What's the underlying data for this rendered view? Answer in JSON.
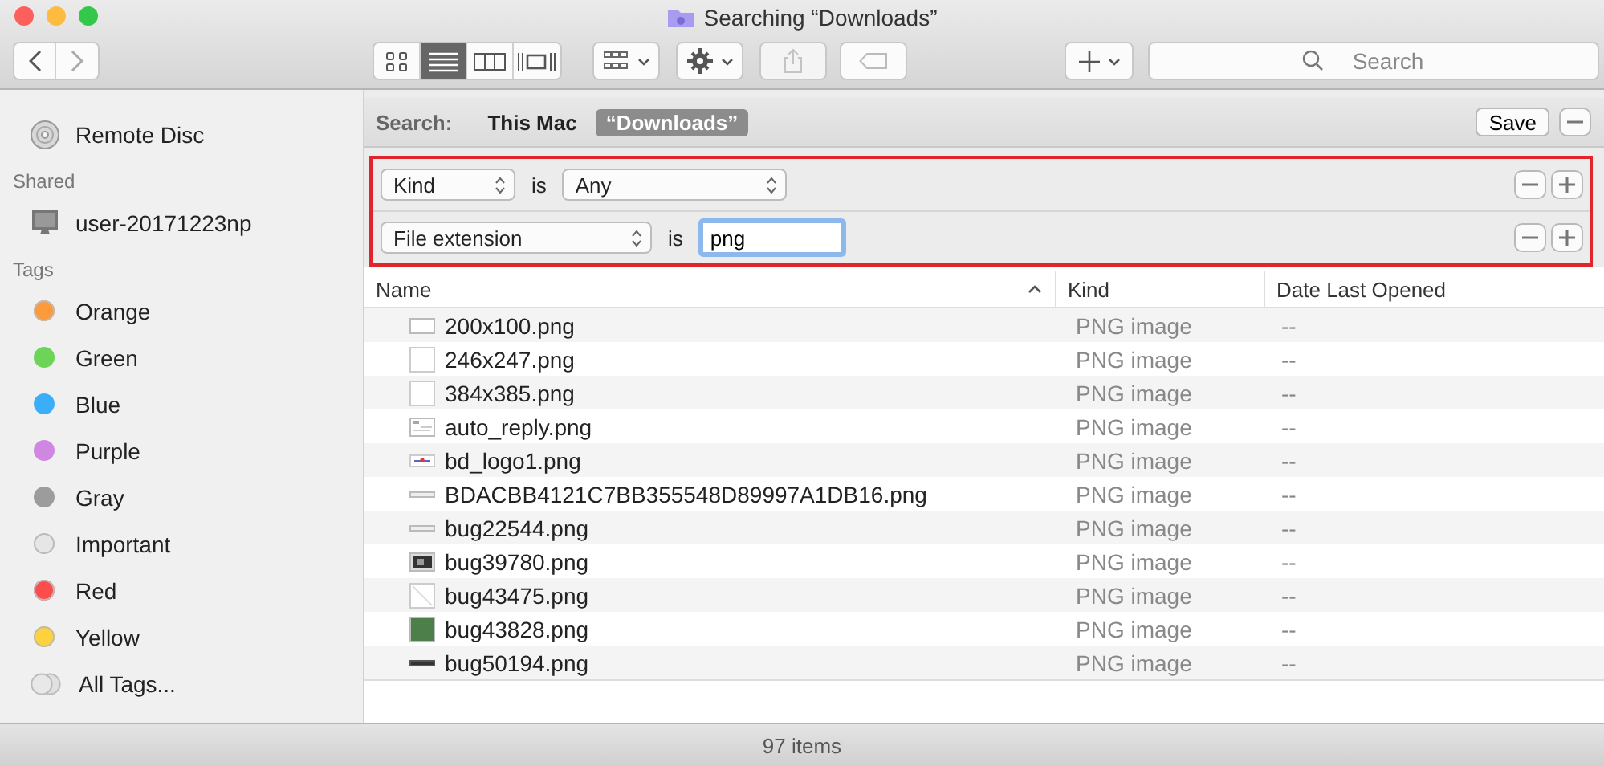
{
  "window": {
    "title": "Searching “Downloads”"
  },
  "toolbar": {
    "views": [
      {
        "kind": "icons",
        "selected": false
      },
      {
        "kind": "list",
        "selected": true
      },
      {
        "kind": "columns",
        "selected": false
      },
      {
        "kind": "gallery",
        "selected": false
      }
    ],
    "share_disabled": true,
    "search": {
      "placeholder": "Search"
    }
  },
  "sidebar": {
    "sections": [
      {
        "items": [
          {
            "label": "Remote Disc",
            "kind": "disc"
          }
        ]
      },
      {
        "title": "Shared",
        "items": [
          {
            "label": "user-20171223np",
            "kind": "computer"
          }
        ]
      },
      {
        "title": "Tags",
        "items": [
          {
            "label": "Orange",
            "kind": "tag",
            "color": "#fd9a3c"
          },
          {
            "label": "Green",
            "kind": "tag",
            "color": "#6cd558"
          },
          {
            "label": "Blue",
            "kind": "tag",
            "color": "#3aaef9"
          },
          {
            "label": "Purple",
            "kind": "tag",
            "color": "#cf87e1"
          },
          {
            "label": "Gray",
            "kind": "tag",
            "color": "#9c9c9c"
          },
          {
            "label": "Important",
            "kind": "tag",
            "color": "#e6e6e6"
          },
          {
            "label": "Red",
            "kind": "tag",
            "color": "#fc4c4c"
          },
          {
            "label": "Yellow",
            "kind": "tag",
            "color": "#fed23e"
          },
          {
            "label": "All Tags...",
            "kind": "alltags"
          }
        ]
      }
    ]
  },
  "search_bar": {
    "label": "Search:",
    "scopes": [
      {
        "label": "This Mac",
        "selected": false
      },
      {
        "label": "“Downloads”",
        "selected": true
      }
    ],
    "save": "Save"
  },
  "criteria": [
    {
      "attribute": "Kind",
      "operator": "is",
      "value": "Any",
      "kind": "popup"
    },
    {
      "attribute": "File extension",
      "operator": "is",
      "value": "png",
      "kind": "field"
    }
  ],
  "table": {
    "columns": [
      {
        "label": "Name",
        "sorted": true
      },
      {
        "label": "Kind",
        "sorted": false
      },
      {
        "label": "Date Last Opened",
        "sorted": false
      }
    ],
    "rows": [
      {
        "name": "200x100.png",
        "thumbnail": {
          "kind": "blank"
        },
        "kind": "PNG image",
        "date": "--"
      },
      {
        "name": "246x247.png",
        "thumbnail": {
          "kind": "page"
        },
        "kind": "PNG image",
        "date": "--"
      },
      {
        "name": "384x385.png",
        "thumbnail": {
          "kind": "page"
        },
        "kind": "PNG image",
        "date": "--"
      },
      {
        "name": "auto_reply.png",
        "thumbnail": {
          "kind": "window"
        },
        "kind": "PNG image",
        "date": "--"
      },
      {
        "name": "bd_logo1.png",
        "thumbnail": {
          "kind": "logo"
        },
        "kind": "PNG image",
        "date": "--"
      },
      {
        "name": "BDACBB4121C7BB355548D89997A1DB16.png",
        "thumbnail": {
          "kind": "line"
        },
        "kind": "PNG image",
        "date": "--"
      },
      {
        "name": "bug22544.png",
        "thumbnail": {
          "kind": "line"
        },
        "kind": "PNG image",
        "date": "--"
      },
      {
        "name": "bug39780.png",
        "thumbnail": {
          "kind": "dark"
        },
        "kind": "PNG image",
        "date": "--"
      },
      {
        "name": "bug43475.png",
        "thumbnail": {
          "kind": "diag"
        },
        "kind": "PNG image",
        "date": "--"
      },
      {
        "name": "bug43828.png",
        "thumbnail": {
          "kind": "green"
        },
        "kind": "PNG image",
        "date": "--"
      },
      {
        "name": "bug50194.png",
        "thumbnail": {
          "kind": "bar"
        },
        "kind": "PNG image",
        "date": "--"
      }
    ]
  },
  "status_bar": {
    "text": "97 items"
  }
}
